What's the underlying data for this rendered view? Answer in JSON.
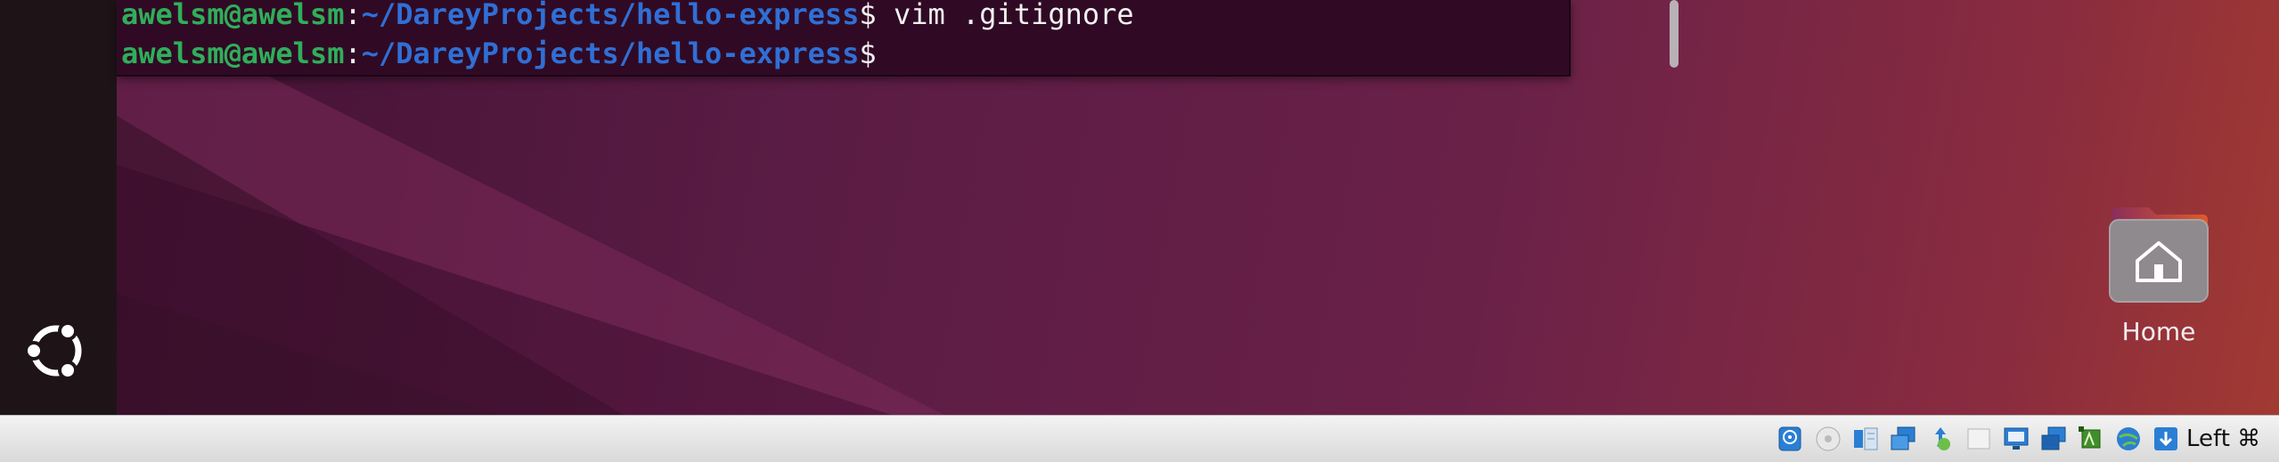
{
  "terminal": {
    "lines": [
      {
        "user": "awelsm@awelsm",
        "sep": ":",
        "path": "~/DareyProjects/hello-express",
        "prompt": "$",
        "command": " vim .gitignore"
      },
      {
        "user": "awelsm@awelsm",
        "sep": ":",
        "path": "~/DareyProjects/hello-express",
        "prompt": "$",
        "command": ""
      }
    ]
  },
  "desktop": {
    "home_label": "Home"
  },
  "statusbar": {
    "icons": [
      "hard-disk-icon",
      "optical-drive-icon",
      "audio-icon",
      "network-icon",
      "usb-icon",
      "shared-folders-icon",
      "display-icon",
      "recording-icon",
      "cpu-icon",
      "mouse-integration-icon",
      "keyboard-capture-icon"
    ],
    "host_key": "Left ⌘"
  },
  "colors": {
    "terminal_bg": "#300a24",
    "user_green": "#2fae5a",
    "path_blue": "#2f6fd6",
    "dock_bg": "#1e1418",
    "wallpaper_start": "#3f1030",
    "wallpaper_end": "#a23a32"
  }
}
